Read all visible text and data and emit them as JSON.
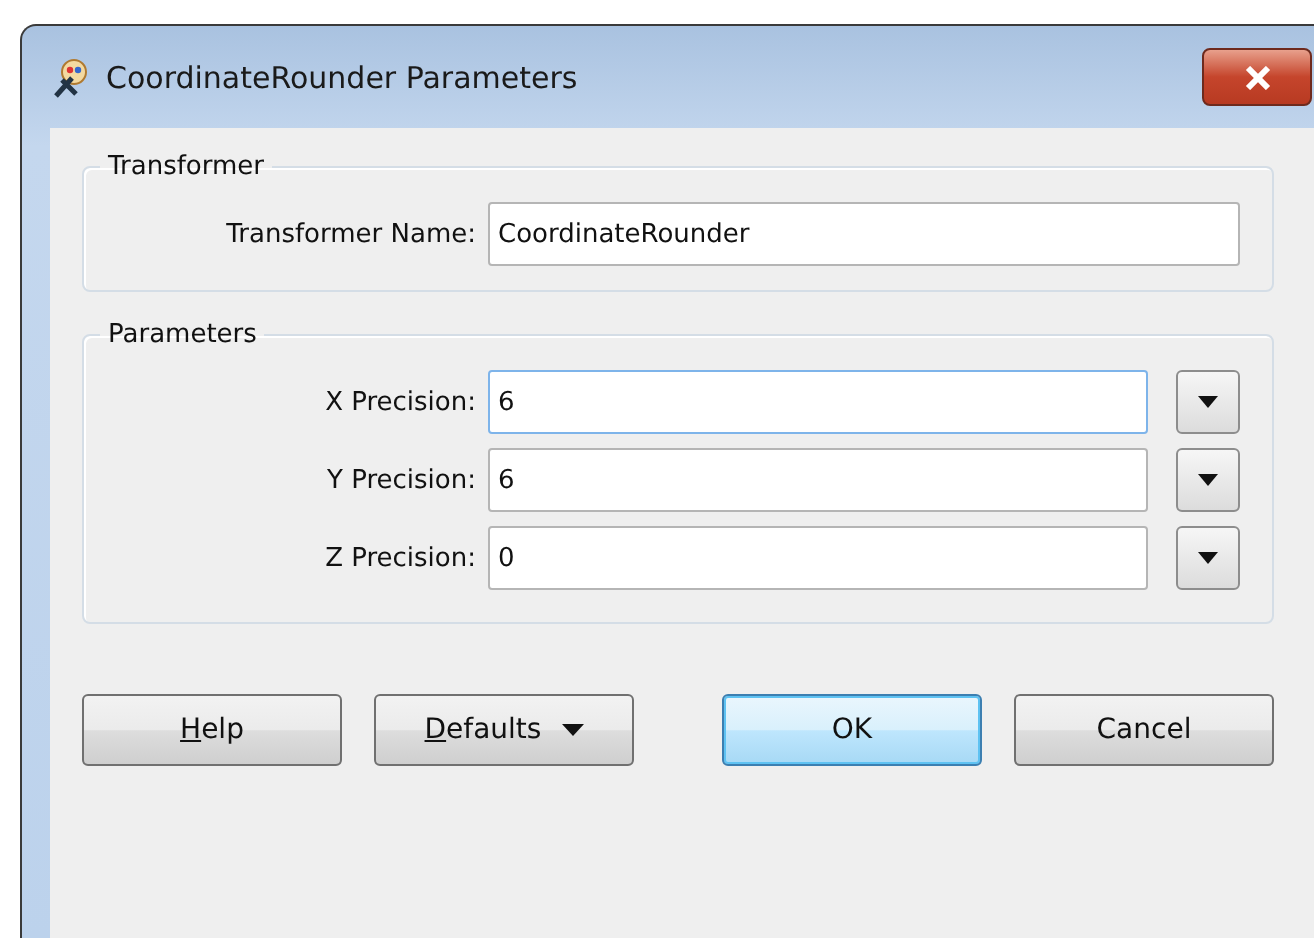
{
  "window": {
    "title": "CoordinateRounder Parameters"
  },
  "groups": [
    {
      "title": "Transformer",
      "fields": [
        {
          "label": "Transformer Name:",
          "value": "CoordinateRounder",
          "focused": false,
          "dropdown": false
        }
      ]
    },
    {
      "title": "Parameters",
      "fields": [
        {
          "label": "X Precision:",
          "value": "6",
          "focused": true,
          "dropdown": true
        },
        {
          "label": "Y Precision:",
          "value": "6",
          "focused": false,
          "dropdown": true
        },
        {
          "label": "Z Precision:",
          "value": "0",
          "focused": false,
          "dropdown": true
        }
      ]
    }
  ],
  "buttons": [
    {
      "label": "Help",
      "underline_first": true,
      "menu": false,
      "default": false
    },
    {
      "label": "Defaults",
      "underline_first": true,
      "menu": true,
      "default": false
    },
    {
      "label": "OK",
      "menu": false,
      "default": true
    },
    {
      "label": "Cancel",
      "menu": false,
      "default": false
    }
  ]
}
